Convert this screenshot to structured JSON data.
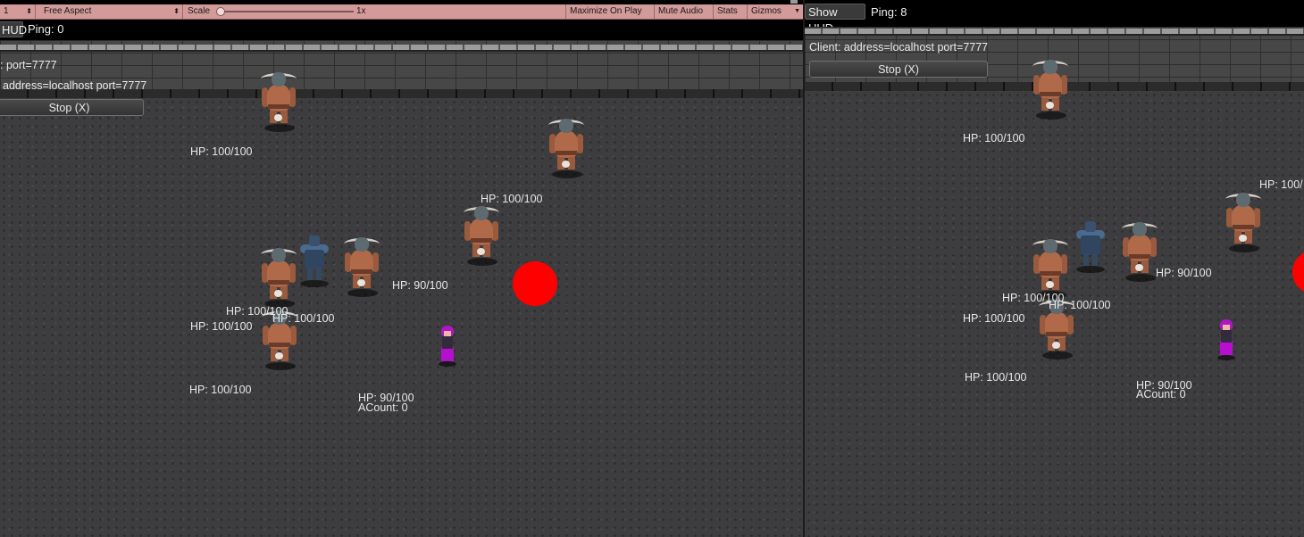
{
  "toolbar": {
    "display_value": "1",
    "aspect": "Free Aspect",
    "scale_label": "Scale",
    "scale_value": "1x",
    "buttons": [
      "Maximize On Play",
      "Mute Audio",
      "Stats",
      "Gizmos"
    ],
    "colors": {
      "toolbar_bg": "#d39a9a"
    }
  },
  "left": {
    "hud_button": "HUD",
    "ping": "Ping: 0",
    "info_server": ": port=7777",
    "info_client": "address=localhost port=7777",
    "stop_button": "Stop (X)",
    "labels": [
      "HP: 100/100",
      "HP: 100/100",
      "HP: 90/100",
      "HP: 100/100",
      "HP: 100/100",
      "HP: 100/100",
      "HP: 100/100",
      "HP: 90/100",
      "ACount: 0"
    ]
  },
  "right": {
    "hud_button": "Show HUD",
    "ping": "Ping: 8",
    "info_client": "Client: address=localhost port=7777",
    "stop_button": "Stop (X)",
    "labels": [
      "HP: 100/100",
      "HP: 100/",
      "HP: 90/100",
      "HP: 100/100",
      "HP: 100/100",
      "HP: 100/100",
      "HP: 100/100",
      "HP: 90/100",
      "ACount: 0"
    ]
  },
  "colors": {
    "ball": "#ff0000",
    "floor": "#3d3d3f",
    "player": "#b60fcf"
  },
  "sprites": [
    "minotaur",
    "armored-knight",
    "purple-mage",
    "red-ball"
  ]
}
